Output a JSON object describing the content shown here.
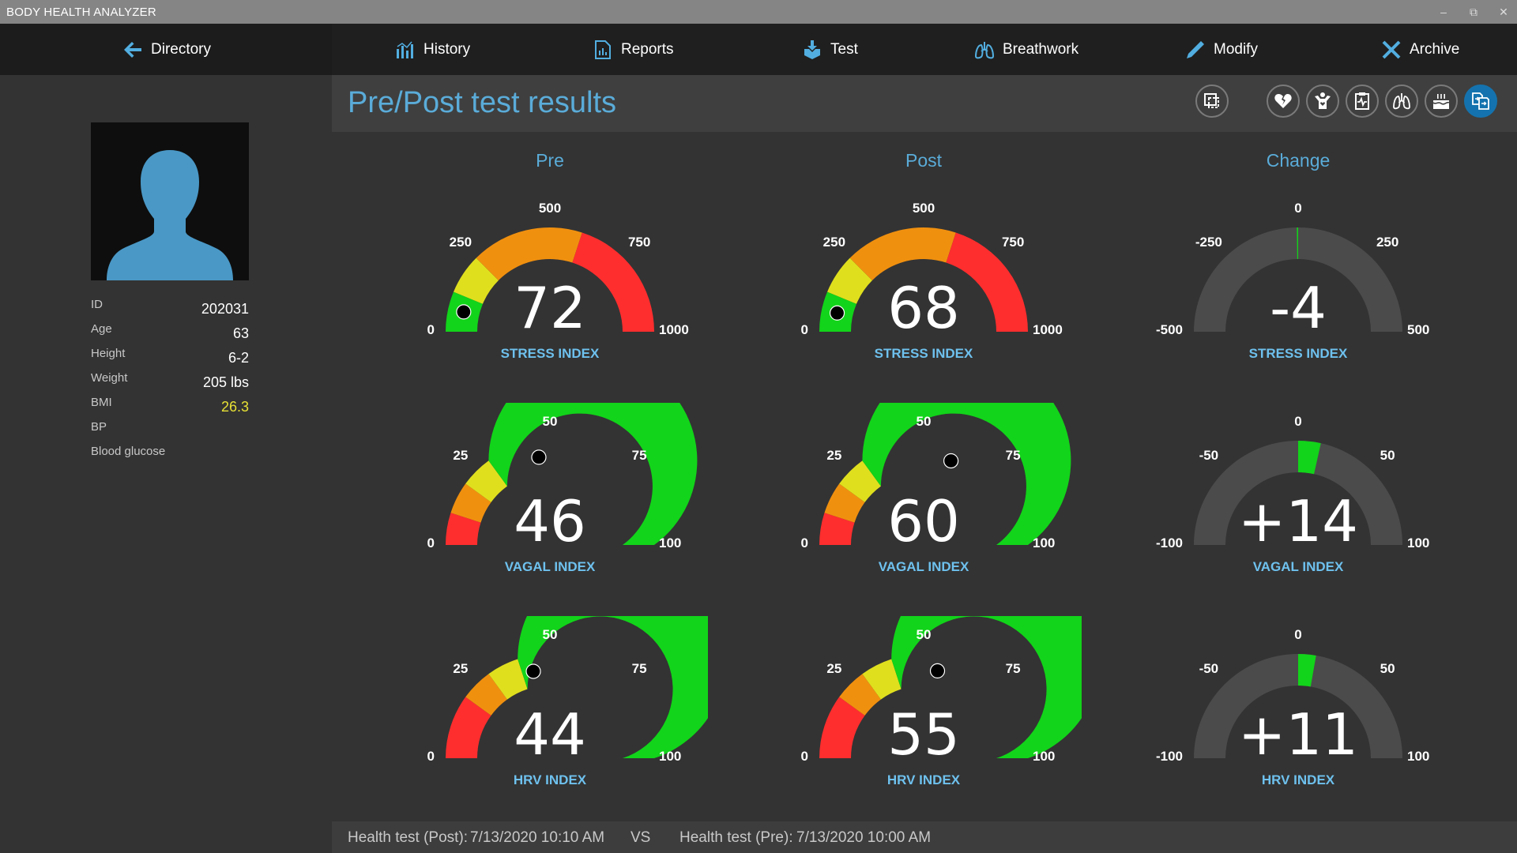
{
  "app": {
    "title": "BODY HEALTH ANALYZER"
  },
  "window_controls": {
    "minimize": "‒",
    "restore": "⧉",
    "close": "✕"
  },
  "nav": {
    "directory": "Directory",
    "history": "History",
    "reports": "Reports",
    "test": "Test",
    "breathwork": "Breathwork",
    "modify": "Modify",
    "archive": "Archive"
  },
  "patient": {
    "fields": [
      {
        "label": "ID",
        "value": "202031"
      },
      {
        "label": "Age",
        "value": "63"
      },
      {
        "label": "Height",
        "value": "6-2"
      },
      {
        "label": "Weight",
        "value": "205 lbs"
      },
      {
        "label": "BMI",
        "value": "26.3"
      },
      {
        "label": "BP",
        "value": ""
      },
      {
        "label": "Blood glucose",
        "value": ""
      }
    ]
  },
  "page": {
    "title": "Pre/Post test results",
    "header_buttons": [
      "select-all",
      "heart-broken",
      "person-heart",
      "clipboard-ekg",
      "lungs",
      "cake",
      "compare"
    ],
    "columns": [
      "Pre",
      "Post",
      "Change"
    ]
  },
  "colors": {
    "accent": "#5aacd9",
    "label": "#6ec1ee",
    "green": "#12d41a",
    "yellow": "#e0df1e",
    "orange": "#f0900f",
    "red": "#fe2e2e",
    "track": "#4b4b4b",
    "bmi": "#e6e035"
  },
  "gauges": {
    "pre": [
      {
        "label": "STRESS INDEX",
        "value": 72,
        "display": "72",
        "min": 0,
        "max": 1000,
        "ticks": [
          "0",
          "250",
          "500",
          "750",
          "1000"
        ],
        "bands": [
          [
            0,
            125,
            "green"
          ],
          [
            125,
            250,
            "yellow"
          ],
          [
            250,
            600,
            "orange"
          ],
          [
            600,
            1000,
            "red"
          ]
        ]
      },
      {
        "label": "VAGAL INDEX",
        "value": 46,
        "display": "46",
        "min": 0,
        "max": 100,
        "ticks": [
          "0",
          "25",
          "50",
          "75",
          "100"
        ],
        "bands": [
          [
            0,
            10,
            "red"
          ],
          [
            10,
            20,
            "orange"
          ],
          [
            20,
            30,
            "yellow"
          ],
          [
            30,
            100,
            "green"
          ]
        ]
      },
      {
        "label": "HRV INDEX",
        "value": 44,
        "display": "44",
        "min": 0,
        "max": 100,
        "ticks": [
          "0",
          "25",
          "50",
          "75",
          "100"
        ],
        "bands": [
          [
            0,
            20,
            "red"
          ],
          [
            20,
            30,
            "orange"
          ],
          [
            30,
            40,
            "yellow"
          ],
          [
            40,
            100,
            "green"
          ]
        ]
      }
    ],
    "post": [
      {
        "label": "STRESS INDEX",
        "value": 68,
        "display": "68",
        "min": 0,
        "max": 1000,
        "ticks": [
          "0",
          "250",
          "500",
          "750",
          "1000"
        ],
        "bands": [
          [
            0,
            125,
            "green"
          ],
          [
            125,
            250,
            "yellow"
          ],
          [
            250,
            600,
            "orange"
          ],
          [
            600,
            1000,
            "red"
          ]
        ]
      },
      {
        "label": "VAGAL INDEX",
        "value": 60,
        "display": "60",
        "min": 0,
        "max": 100,
        "ticks": [
          "0",
          "25",
          "50",
          "75",
          "100"
        ],
        "bands": [
          [
            0,
            10,
            "red"
          ],
          [
            10,
            20,
            "orange"
          ],
          [
            20,
            30,
            "yellow"
          ],
          [
            30,
            100,
            "green"
          ]
        ]
      },
      {
        "label": "HRV INDEX",
        "value": 55,
        "display": "55",
        "min": 0,
        "max": 100,
        "ticks": [
          "0",
          "25",
          "50",
          "75",
          "100"
        ],
        "bands": [
          [
            0,
            20,
            "red"
          ],
          [
            20,
            30,
            "orange"
          ],
          [
            30,
            40,
            "yellow"
          ],
          [
            40,
            100,
            "green"
          ]
        ]
      }
    ],
    "change": [
      {
        "label": "STRESS INDEX",
        "value": -4,
        "display": "-4",
        "min": -500,
        "max": 500,
        "ticks": [
          "-500",
          "-250",
          "0",
          "250",
          "500"
        ]
      },
      {
        "label": "VAGAL INDEX",
        "value": 14,
        "display": "+14",
        "min": -100,
        "max": 100,
        "ticks": [
          "-100",
          "-50",
          "0",
          "50",
          "100"
        ]
      },
      {
        "label": "HRV INDEX",
        "value": 11,
        "display": "+11",
        "min": -100,
        "max": 100,
        "ticks": [
          "-100",
          "-50",
          "0",
          "50",
          "100"
        ]
      }
    ]
  },
  "footer": {
    "post_label": "Health test (Post):",
    "post_time": "7/13/2020 10:10 AM",
    "vs": "VS",
    "pre_label": "Health test (Pre):",
    "pre_time": "7/13/2020 10:00 AM"
  }
}
